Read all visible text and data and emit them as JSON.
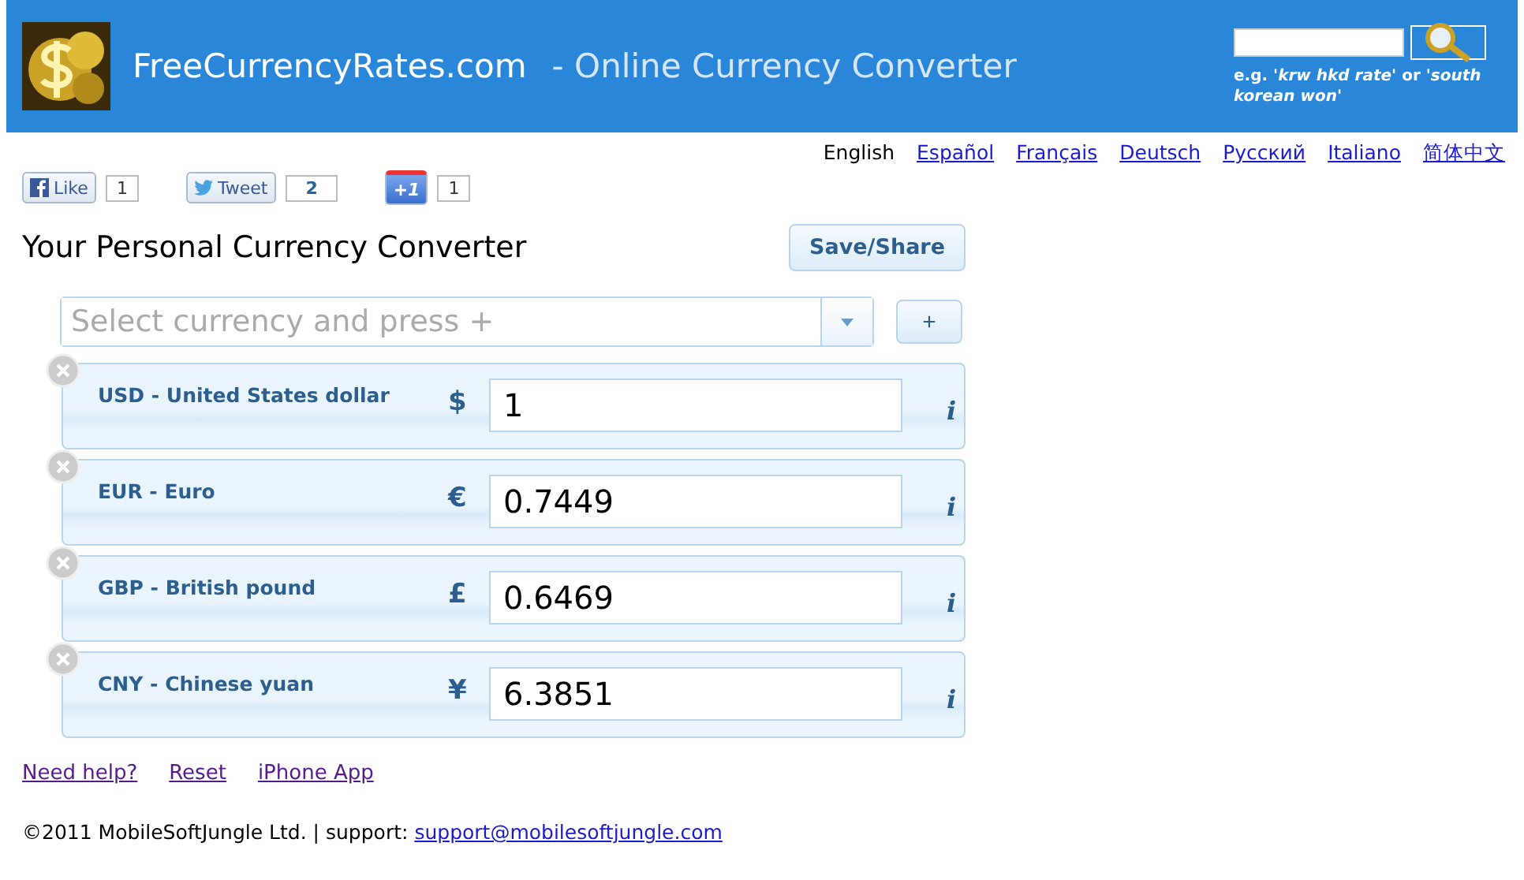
{
  "header": {
    "site_name": "FreeCurrencyRates.com",
    "tagline": "- Online Currency Converter",
    "search_hint": "e.g. *'krw hkd rate'* or *'south korean won'*"
  },
  "languages": [
    {
      "label": "English",
      "selected": true
    },
    {
      "label": "Español",
      "selected": false
    },
    {
      "label": "Français",
      "selected": false
    },
    {
      "label": "Deutsch",
      "selected": false
    },
    {
      "label": "Русский",
      "selected": false
    },
    {
      "label": "Italiano",
      "selected": false
    },
    {
      "label": "简体中文",
      "selected": false
    }
  ],
  "social": [
    {
      "kind": "facebook",
      "label": "Like",
      "count": "1"
    },
    {
      "kind": "twitter",
      "label": "Tweet",
      "count": "2"
    },
    {
      "kind": "plusone",
      "label": "+1",
      "count": "1"
    }
  ],
  "heading": "Your Personal Currency Converter",
  "save_button": "Save/Share",
  "currency_select": {
    "placeholder": "Select currency and press +",
    "add_button": "+"
  },
  "rows": [
    {
      "name": "USD - United States dollar",
      "symbol": "$",
      "value": "1",
      "info": "i"
    },
    {
      "name": "EUR - Euro",
      "symbol": "€",
      "value": "0.7449",
      "info": "i"
    },
    {
      "name": "GBP - British pound",
      "symbol": "£",
      "value": "0.6469",
      "info": "i"
    },
    {
      "name": "CNY - Chinese yuan",
      "symbol": "¥",
      "value": "6.3851",
      "info": "i"
    }
  ],
  "links": [
    "Need help?",
    "Reset",
    "iPhone App"
  ],
  "footer": {
    "text": "©2011 MobileSoftJungle Ltd. | support:",
    "email": "support@mobilesoftjungle.com"
  }
}
